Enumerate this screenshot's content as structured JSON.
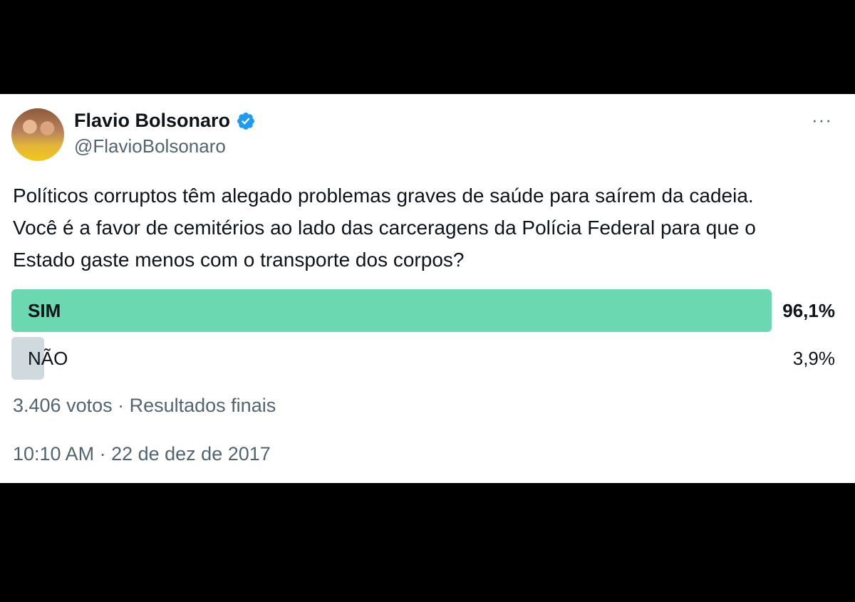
{
  "author": {
    "name": "Flavio Bolsonaro",
    "handle": "@FlavioBolsonaro",
    "verified_icon": "verified-badge-icon"
  },
  "more_icon": "more-horizontal-icon",
  "more_label": "···",
  "tweet": {
    "lines": [
      "Políticos corruptos têm alegado problemas graves de saúde para saírem da cadeia.",
      "Você é a favor de cemitérios ao lado das carceragens da Polícia Federal para que o",
      "Estado gaste menos com o transporte dos corpos?"
    ]
  },
  "poll": {
    "options": [
      {
        "label": "SIM",
        "percent_text": "96,1%",
        "percent": 96.1,
        "winner": true
      },
      {
        "label": "NÃO",
        "percent_text": "3,9%",
        "percent": 3.9,
        "winner": false
      }
    ],
    "votes_summary": "3.406 votos · Resultados finais"
  },
  "timestamp": "10:10 AM · 22 de dez de 2017",
  "colors": {
    "winner_bar": "#6cd8b2",
    "loser_bar": "#cfd9de",
    "verified": "#1d9bf0",
    "secondary_text": "#536471"
  }
}
